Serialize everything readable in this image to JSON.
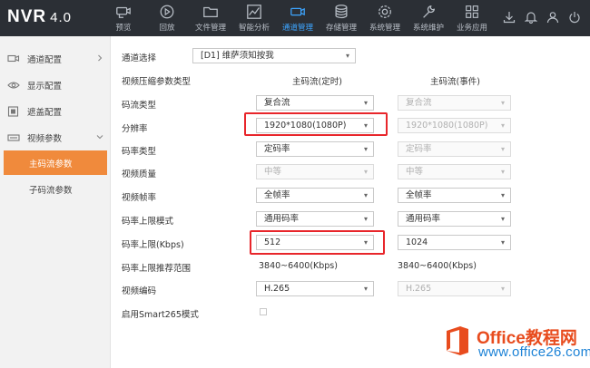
{
  "app": {
    "name": "NVR",
    "version": "4.0"
  },
  "nav": [
    {
      "label": "预览",
      "icon": "camera-icon"
    },
    {
      "label": "回放",
      "icon": "playback-icon"
    },
    {
      "label": "文件管理",
      "icon": "folder-icon"
    },
    {
      "label": "智能分析",
      "icon": "analytics-icon"
    },
    {
      "label": "通道管理",
      "icon": "channel-camera-icon",
      "active": true
    },
    {
      "label": "存储管理",
      "icon": "database-icon"
    },
    {
      "label": "系统管理",
      "icon": "gear-icon"
    },
    {
      "label": "系统维护",
      "icon": "wrench-icon"
    },
    {
      "label": "业务应用",
      "icon": "apps-grid-icon"
    }
  ],
  "tools": [
    "download-icon",
    "bell-icon",
    "user-icon",
    "power-icon"
  ],
  "sidebar": {
    "items": [
      {
        "label": "通道配置",
        "icon": "channel-config-icon"
      },
      {
        "label": "显示配置",
        "icon": "eye-icon"
      },
      {
        "label": "遮盖配置",
        "icon": "mask-icon"
      },
      {
        "label": "视频参数",
        "icon": "video-param-icon"
      }
    ],
    "sub": [
      {
        "label": "主码流参数",
        "active": true
      },
      {
        "label": "子码流参数"
      }
    ]
  },
  "form": {
    "channel_label": "通道选择",
    "channel_value": "[D1] 维萨须知按我",
    "compress_type_label": "视频压缩参数类型",
    "col_main": "主码流(定时)",
    "col_event": "主码流(事件)",
    "rows": [
      {
        "label": "码流类型",
        "main": "复合流",
        "event": "复合流"
      },
      {
        "label": "分辨率",
        "main": "1920*1080(1080P)",
        "event": "1920*1080(1080P)"
      },
      {
        "label": "码率类型",
        "main": "定码率",
        "event": "定码率"
      },
      {
        "label": "视频质量",
        "main": "中等",
        "event": "中等"
      },
      {
        "label": "视频帧率",
        "main": "全帧率",
        "event": "全帧率"
      },
      {
        "label": "码率上限模式",
        "main": "通用码率",
        "event": "通用码率"
      },
      {
        "label": "码率上限(Kbps)",
        "main": "512",
        "event": "1024"
      },
      {
        "label": "码率上限推荐范围",
        "main": "3840~6400(Kbps)",
        "event": "3840~6400(Kbps)"
      },
      {
        "label": "视频编码",
        "main": "H.265",
        "event": "H.265"
      },
      {
        "label": "启用Smart265模式"
      }
    ]
  },
  "watermark": {
    "line1": "Office教程网",
    "line2": "www.office26.com"
  },
  "colors": {
    "topbar": "#2b2f35",
    "active_nav": "#3da5ff",
    "active_sidebar": "#f08a3c",
    "highlight": "#e8262b"
  }
}
